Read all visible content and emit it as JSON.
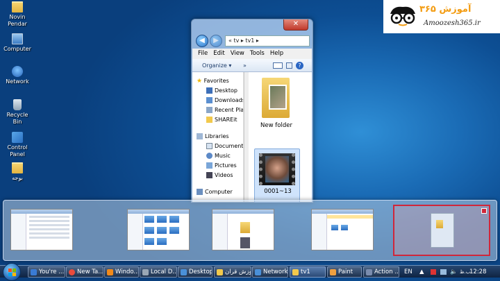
{
  "desktop": {
    "icons": [
      {
        "label": "Novin Pendar",
        "icon": "folder-icon"
      },
      {
        "label": "Computer",
        "icon": "computer-icon"
      },
      {
        "label": "Network",
        "icon": "network-icon"
      },
      {
        "label": "Recycle Bin",
        "icon": "recycle-bin-icon"
      },
      {
        "label": "Control Panel",
        "icon": "control-panel-icon"
      },
      {
        "label": "بوجه",
        "icon": "folder-icon"
      }
    ]
  },
  "logo": {
    "brand_fa": "آموزش ۳۶۵",
    "brand_en": "Amoozesh365.ir"
  },
  "explorer": {
    "close_label": "✕",
    "back_label": "◀",
    "forward_label": "▶",
    "address": "« tv ▸ tv1 ▸",
    "menu": [
      "File",
      "Edit",
      "View",
      "Tools",
      "Help"
    ],
    "toolbar": {
      "organize": "Organize ▾",
      "more": "»",
      "help": "?"
    },
    "nav_pane": {
      "favorites_label": "Favorites",
      "favorites": [
        "Desktop",
        "Downloads",
        "Recent Places",
        "SHAREit"
      ],
      "libraries_label": "Libraries",
      "libraries": [
        "Documents",
        "Music",
        "Pictures",
        "Videos"
      ],
      "computer_label": "Computer"
    },
    "files": [
      {
        "name": "New folder",
        "type": "folder"
      },
      {
        "name": "0001~13",
        "type": "video",
        "selected": true
      }
    ]
  },
  "switcher": {
    "active_index": 4,
    "windows": [
      "You're ...",
      "Windows",
      "tv1",
      "Network",
      "Desktop"
    ]
  },
  "taskbar": {
    "buttons": [
      {
        "label": "You're ...",
        "color": "#3a7bd5"
      },
      {
        "label": "New Ta...",
        "color": "#e94b3c"
      },
      {
        "label": "Windo...",
        "color": "#f28a1a"
      },
      {
        "label": "Local D...",
        "color": "#9aa7b5"
      },
      {
        "label": "Desktop",
        "color": "#4a90d9"
      },
      {
        "label": "آموزش قران",
        "color": "#f2c94c"
      },
      {
        "label": "Network",
        "color": "#4a90d9"
      },
      {
        "label": "tv1",
        "color": "#f2c94c",
        "pressed": true
      },
      {
        "label": "Paint",
        "color": "#f0a040"
      },
      {
        "label": "Action ...",
        "color": "#7a8cae"
      }
    ],
    "language": "EN",
    "clock_time": "12:28",
    "clock_period": "ب.ظ"
  }
}
